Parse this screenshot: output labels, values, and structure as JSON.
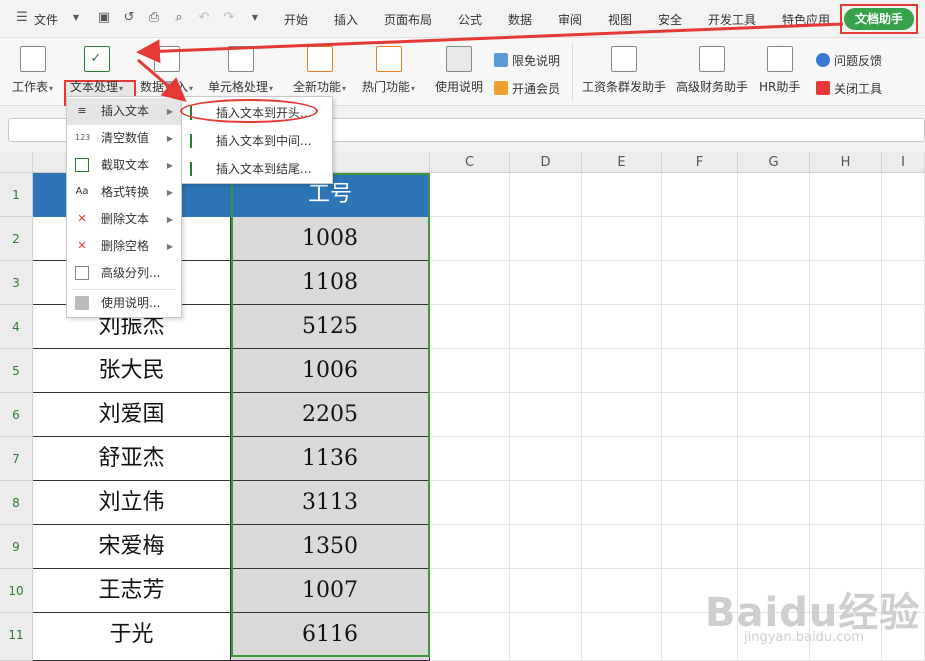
{
  "menubar": {
    "file": "文件",
    "tabs": [
      "开始",
      "插入",
      "页面布局",
      "公式",
      "数据",
      "审阅",
      "视图",
      "安全",
      "开发工具",
      "特色应用"
    ],
    "assistant_tab": "文档助手"
  },
  "ribbon": {
    "worksheet": "工作表",
    "text_process": "文本处理",
    "data_entry": "数据录入",
    "cell_process": "单元格处理",
    "new_function": "全新功能",
    "hot_function": "热门功能",
    "usage": "使用说明",
    "free_info": "限免说明",
    "vip": "开通会员",
    "salary": "工资条群发助手",
    "finance": "高级财务助手",
    "hr": "HR助手",
    "feedback": "问题反馈",
    "close_tool": "关闭工具"
  },
  "columns": [
    "C",
    "D",
    "E",
    "F",
    "G",
    "H",
    "I"
  ],
  "rows": [
    "1",
    "2",
    "3",
    "4",
    "5",
    "6",
    "7",
    "8",
    "9",
    "10",
    "11"
  ],
  "table": {
    "header_b": "工号",
    "names": [
      "",
      "",
      "",
      "刘振杰",
      "张大民",
      "刘爱国",
      "舒亚杰",
      "刘立伟",
      "宋爱梅",
      "王志芳",
      "于光"
    ],
    "ids": [
      "",
      "1008",
      "1108",
      "5125",
      "1006",
      "2205",
      "1136",
      "3113",
      "1350",
      "1007",
      "6116"
    ]
  },
  "menu": {
    "items": [
      "插入文本",
      "清空数值",
      "截取文本",
      "格式转换",
      "删除文本",
      "删除空格",
      "高级分列...",
      "使用说明..."
    ],
    "icons": [
      "align-icon",
      "123",
      "crop-icon",
      "Aa",
      "delete-text-icon",
      "delete-space-icon",
      "split-icon",
      "doc-icon"
    ]
  },
  "submenu": {
    "items": [
      "插入文本到开头...",
      "插入文本到中间...",
      "插入文本到结尾..."
    ]
  },
  "watermark": {
    "brand": "Baidu经验",
    "url": "jingyan.baidu.com"
  },
  "colors": {
    "header_blue": "#2e75b6",
    "selection_green": "#3b9a3b",
    "assistant_green": "#36a24a",
    "annotation_red": "#e53935"
  }
}
